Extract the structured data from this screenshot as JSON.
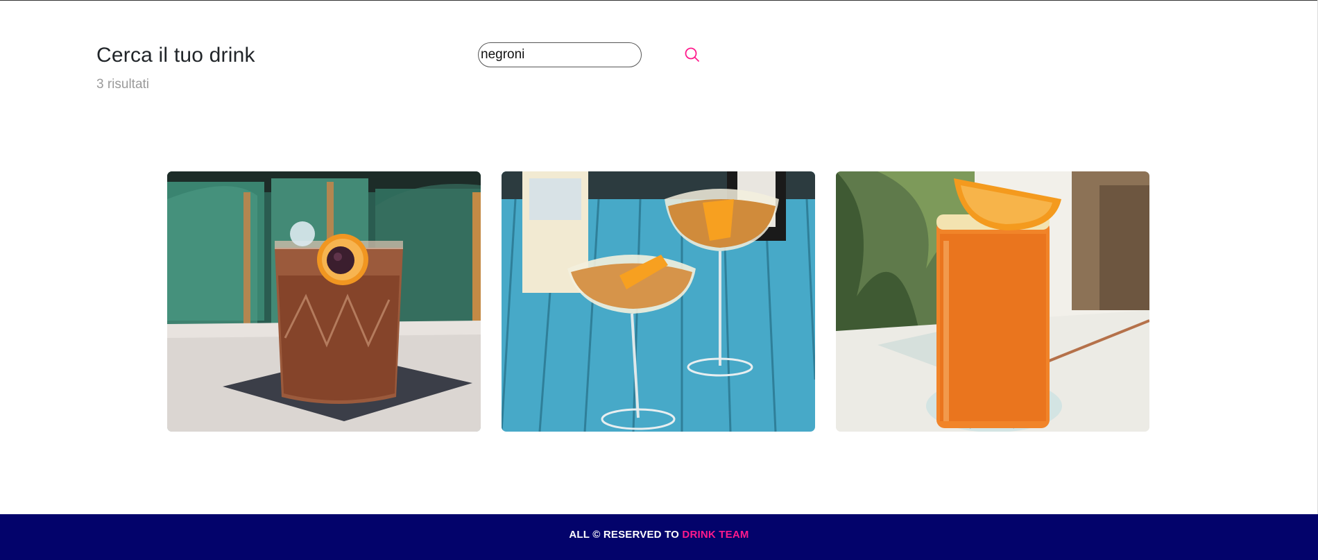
{
  "header": {
    "title": "Cerca il tuo drink",
    "result_count": "3 risultati"
  },
  "search": {
    "value": "negroni",
    "button_icon": "search-icon"
  },
  "results": [
    {
      "image": "negroni-rocks-glass-with-orange-and-cherry"
    },
    {
      "image": "two-coupe-glasses-with-orange-twist"
    },
    {
      "image": "tall-glass-with-orange-wedge"
    }
  ],
  "footer": {
    "text": "ALL © RESERVED TO ",
    "link_label": "DRINK TEAM"
  },
  "colors": {
    "accent": "#ff1a8c",
    "footer_bg": "#03036b",
    "title": "#212529",
    "muted": "#9a9a9a"
  }
}
